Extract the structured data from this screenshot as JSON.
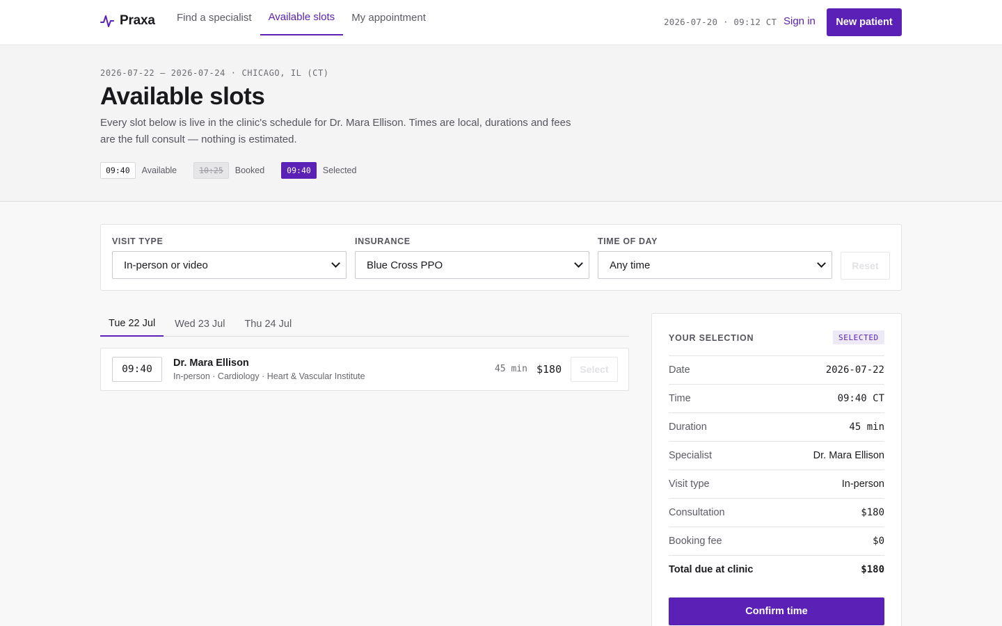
{
  "colors": {
    "accent": "#5b21b6",
    "background": "#f8f8f8"
  },
  "header": {
    "brand": "Praxa",
    "logo_icon": "pulse-icon",
    "nav": [
      {
        "label": "Find a specialist",
        "active": false
      },
      {
        "label": "Available slots",
        "active": true
      },
      {
        "label": "My appointment",
        "active": false
      }
    ],
    "clock": "2026-07-20 · 09:12 CT",
    "sign_in": "Sign in",
    "new_patient": "New patient"
  },
  "hero": {
    "eyebrow": "2026-07-22 — 2026-07-24 · CHICAGO, IL (CT)",
    "title": "Available slots",
    "lede": "Every slot below is live in the clinic's schedule for Dr. Mara Ellison. Times are local, durations and fees are the full consult — nothing is estimated.",
    "legend": [
      {
        "chip": "09:40",
        "label": "Available",
        "kind": "available"
      },
      {
        "chip": "10:25",
        "label": "Booked",
        "kind": "booked"
      },
      {
        "chip": "09:40",
        "label": "Selected",
        "kind": "selected"
      }
    ]
  },
  "filters": {
    "visit_type": {
      "label": "VISIT TYPE",
      "value": "In-person or video"
    },
    "insurance": {
      "label": "INSURANCE",
      "value": "Blue Cross PPO"
    },
    "time_of_day": {
      "label": "TIME OF DAY",
      "value": "Any time"
    },
    "reset": "Reset"
  },
  "tabs": [
    {
      "label": "Tue 22 Jul",
      "active": true
    },
    {
      "label": "Wed 23 Jul",
      "active": false
    },
    {
      "label": "Thu 24 Jul",
      "active": false
    }
  ],
  "slots": [
    {
      "time": "09:40",
      "doctor": "Dr. Mara Ellison",
      "meta": "In-person · Cardiology · Heart & Vascular Institute",
      "duration": "45 min",
      "price": "$180",
      "action": "Select"
    }
  ],
  "selection": {
    "title": "YOUR SELECTION",
    "badge": "SELECTED",
    "rows": [
      {
        "label": "Date",
        "value": "2026-07-22"
      },
      {
        "label": "Time",
        "value": "09:40 CT"
      },
      {
        "label": "Duration",
        "value": "45 min"
      },
      {
        "label": "Specialist",
        "value": "Dr. Mara Ellison"
      },
      {
        "label": "Visit type",
        "value": "In-person"
      },
      {
        "label": "Consultation",
        "value": "$180"
      },
      {
        "label": "Booking fee",
        "value": "$0"
      },
      {
        "label": "Total due at clinic",
        "value": "$180"
      }
    ],
    "confirm": "Confirm time"
  }
}
